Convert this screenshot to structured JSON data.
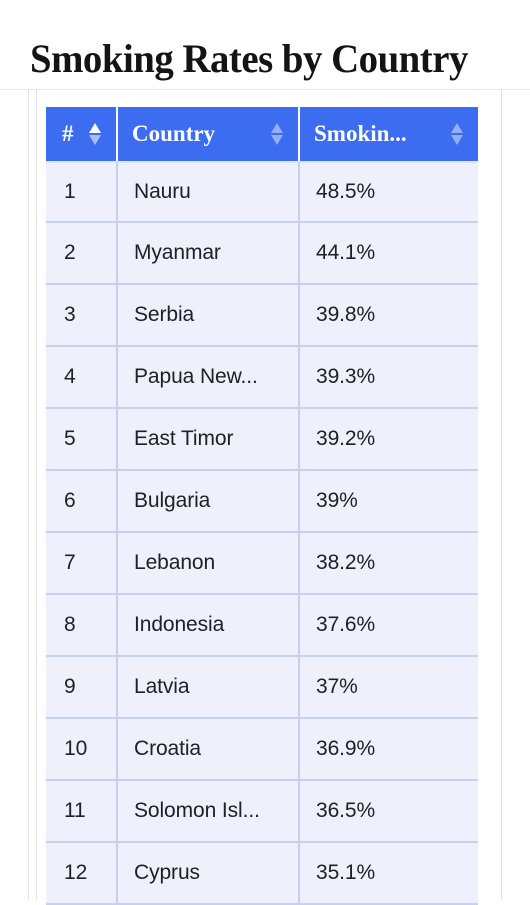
{
  "page": {
    "title": "Smoking Rates by Country"
  },
  "table": {
    "columns": [
      {
        "key": "rank",
        "label": "#",
        "sort_icon": "sort-arrows-icon",
        "sort_active": true
      },
      {
        "key": "country",
        "label": "Country",
        "sort_icon": "sort-arrows-icon",
        "sort_active": false
      },
      {
        "key": "rate",
        "label": "Smokin...",
        "sort_icon": "sort-arrows-icon",
        "sort_active": false
      }
    ],
    "rows": [
      {
        "rank": "1",
        "country": "Nauru",
        "rate": "48.5%"
      },
      {
        "rank": "2",
        "country": "Myanmar",
        "rate": "44.1%"
      },
      {
        "rank": "3",
        "country": "Serbia",
        "rate": "39.8%"
      },
      {
        "rank": "4",
        "country": "Papua New...",
        "rate": "39.3%"
      },
      {
        "rank": "5",
        "country": "East Timor",
        "rate": "39.2%"
      },
      {
        "rank": "6",
        "country": "Bulgaria",
        "rate": "39%"
      },
      {
        "rank": "7",
        "country": "Lebanon",
        "rate": "38.2%"
      },
      {
        "rank": "8",
        "country": "Indonesia",
        "rate": "37.6%"
      },
      {
        "rank": "9",
        "country": "Latvia",
        "rate": "37%"
      },
      {
        "rank": "10",
        "country": "Croatia",
        "rate": "36.9%"
      },
      {
        "rank": "11",
        "country": "Solomon Isl...",
        "rate": "36.5%"
      },
      {
        "rank": "12",
        "country": "Cyprus",
        "rate": "35.1%"
      }
    ]
  },
  "colors": {
    "header_blue": "#3c6df0",
    "row_background": "#eef1fb",
    "row_border": "#c6d0f2",
    "title_text": "#141414",
    "cell_text": "#202124"
  }
}
